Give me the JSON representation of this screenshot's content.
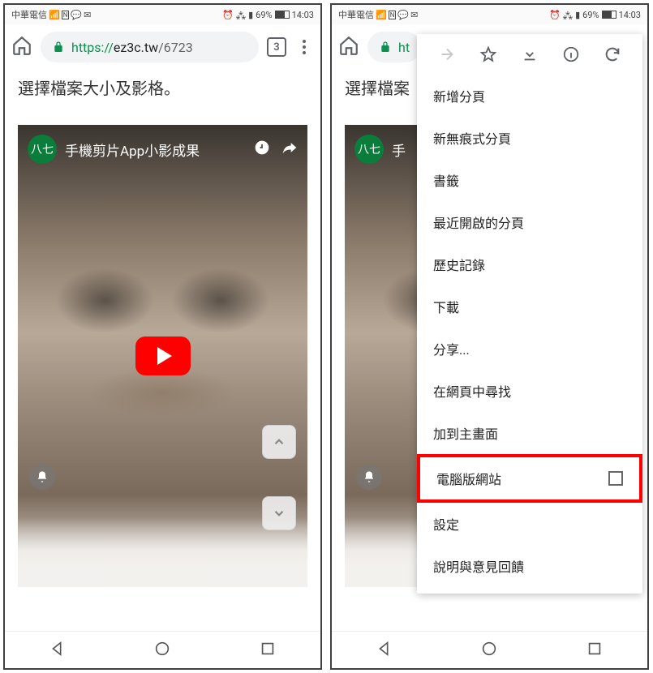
{
  "status": {
    "carrier": "中華電信",
    "battery": "69%",
    "time": "14:03"
  },
  "browser": {
    "url_prefix": "https://",
    "url_host": "ez3c.tw",
    "url_path": "/6723",
    "url_short": "ht",
    "tab_count": "3"
  },
  "page": {
    "text": "選擇檔案大小及影格。",
    "text_partial": "選擇檔案"
  },
  "video": {
    "avatar_label": "八七",
    "title": "手機剪片App小影成果",
    "title_partial": "手"
  },
  "menu": {
    "items": [
      {
        "label": "新增分頁",
        "checkbox": false,
        "highlight": false
      },
      {
        "label": "新無痕式分頁",
        "checkbox": false,
        "highlight": false
      },
      {
        "label": "書籤",
        "checkbox": false,
        "highlight": false
      },
      {
        "label": "最近開啟的分頁",
        "checkbox": false,
        "highlight": false
      },
      {
        "label": "歷史記錄",
        "checkbox": false,
        "highlight": false
      },
      {
        "label": "下載",
        "checkbox": false,
        "highlight": false
      },
      {
        "label": "分享...",
        "checkbox": false,
        "highlight": false
      },
      {
        "label": "在網頁中尋找",
        "checkbox": false,
        "highlight": false
      },
      {
        "label": "加到主畫面",
        "checkbox": false,
        "highlight": false
      },
      {
        "label": "電腦版網站",
        "checkbox": true,
        "highlight": true
      },
      {
        "label": "設定",
        "checkbox": false,
        "highlight": false
      },
      {
        "label": "說明與意見回饋",
        "checkbox": false,
        "highlight": false
      }
    ]
  }
}
